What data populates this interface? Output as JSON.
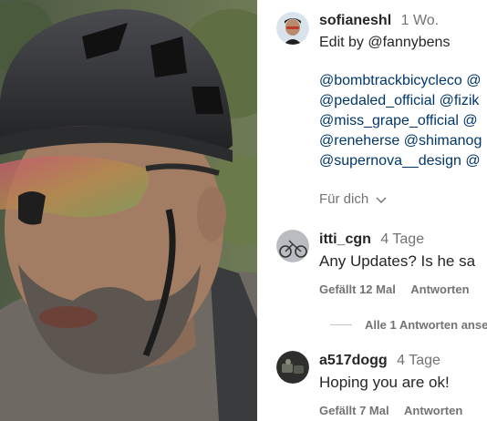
{
  "post": {
    "username": "sofianeshl",
    "time": "1 Wo.",
    "caption": "Edit by @fannybens",
    "mentions": [
      "@bombtrackbicycleco @",
      "@pedaled_official @fizik",
      "@miss_grape_official @",
      "@reneherse @shimanog",
      "@supernova__design @"
    ]
  },
  "sort": {
    "label": "Für dich",
    "icon": "chevron-down-icon"
  },
  "comments": [
    {
      "username": "itti_cgn",
      "time": "4 Tage",
      "text": "Any Updates? Is he sa",
      "likes": "Gefällt 12 Mal",
      "reply": "Antworten",
      "view_replies": "Alle 1 Antworten anse"
    },
    {
      "username": "a517dogg",
      "time": "4 Tage",
      "text": "Hoping you are ok!",
      "likes": "Gefällt 7 Mal",
      "reply": "Antworten"
    }
  ],
  "colors": {
    "link": "#00376b",
    "muted": "#737373",
    "text": "#262626"
  }
}
